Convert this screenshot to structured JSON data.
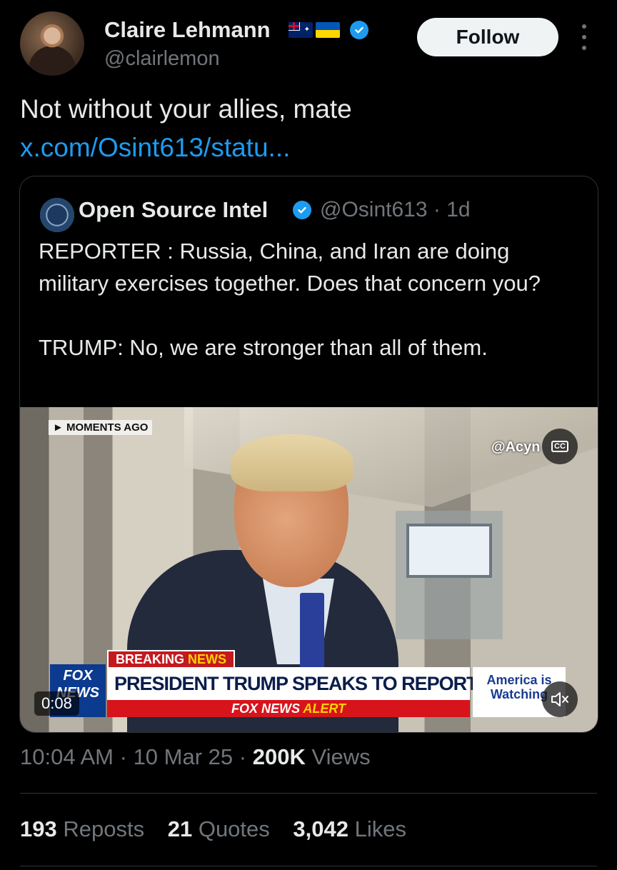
{
  "author": {
    "display_name": "Claire Lehmann",
    "handle": "@clairlemon",
    "flags": [
      "australia-flag-icon",
      "ukraine-flag-icon"
    ],
    "verified": true
  },
  "follow_button": {
    "label": "Follow"
  },
  "tweet": {
    "text": "Not without your allies, mate",
    "link": "x.com/Osint613/statu..."
  },
  "quoted": {
    "display_name": "Open Source Intel",
    "handle": "@Osint613",
    "separator": "·",
    "age": "1d",
    "text_line1": "REPORTER : Russia, China, and Iran are doing military exercises together. Does that concern you?",
    "text_line2": "TRUMP: No, we are stronger than all of them."
  },
  "video": {
    "badge": "► MOMENTS AGO",
    "watermark": "@Acyn",
    "cc_label": "CC",
    "breaking": "BREAKING",
    "breaking_news": "NEWS",
    "headline": "PRESIDENT TRUMP SPEAKS TO REPORTERS",
    "alert_prefix": "FOX NEWS",
    "alert_suffix": "ALERT",
    "logo": "FOX NEWS",
    "side_box": "America is Watching",
    "elapsed": "0:08"
  },
  "meta": {
    "time": "10:04 AM",
    "date": "10 Mar 25",
    "views_count": "200K",
    "views_label": "Views",
    "sep": "·"
  },
  "stats": {
    "reposts_count": "193",
    "reposts_label": "Reposts",
    "quotes_count": "21",
    "quotes_label": "Quotes",
    "likes_count": "3,042",
    "likes_label": "Likes"
  },
  "colors": {
    "accent": "#1d9bf0",
    "background": "#000000",
    "muted": "#71767b"
  }
}
